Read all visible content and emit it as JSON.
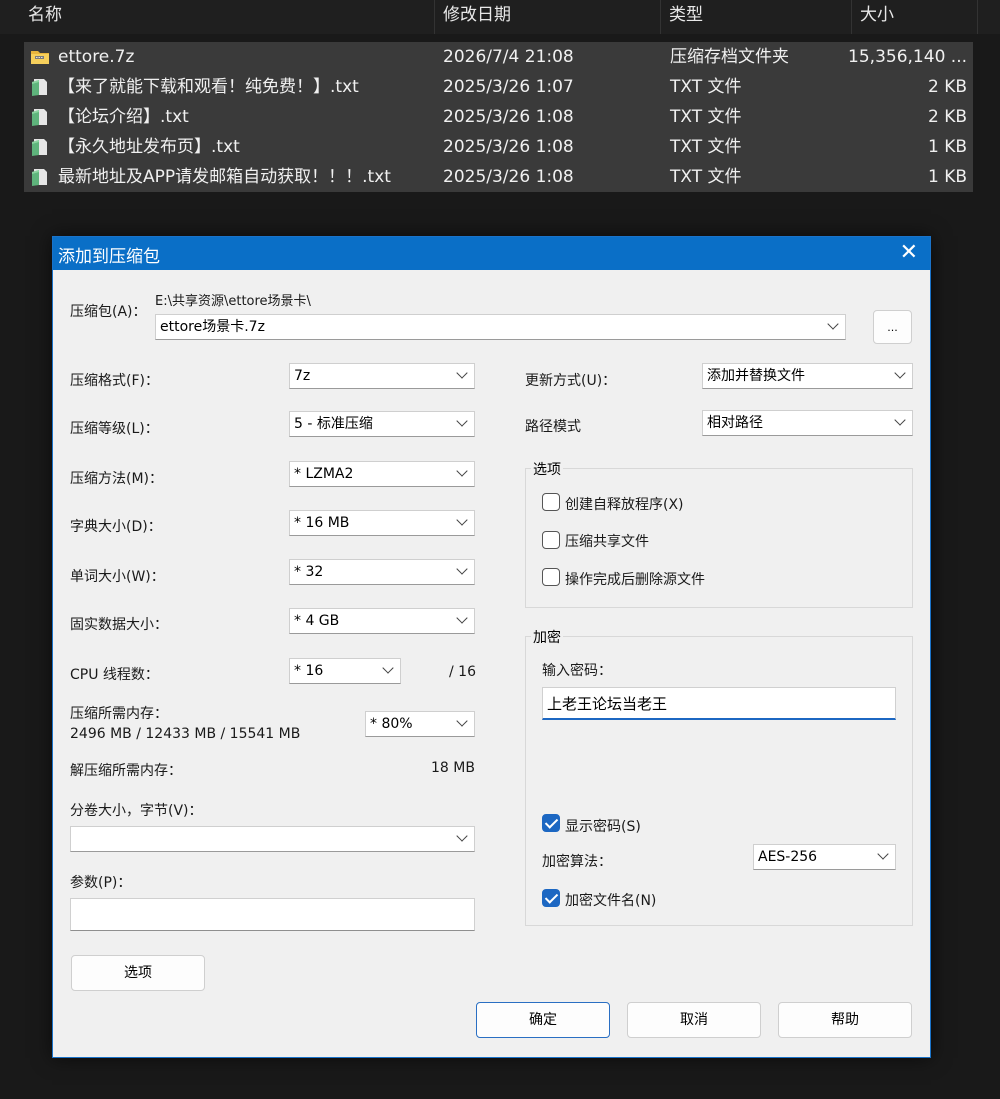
{
  "explorer": {
    "columns": {
      "name": "名称",
      "date": "修改日期",
      "type": "类型",
      "size": "大小"
    },
    "files": [
      {
        "icon": "zip-folder-icon",
        "name": "ettore.7z",
        "date": "2026/7/4 21:08",
        "type": "压缩存档文件夹",
        "size": "15,356,140 ..."
      },
      {
        "icon": "text-file-icon",
        "name": "【来了就能下载和观看！纯免费！】.txt",
        "date": "2025/3/26 1:07",
        "type": "TXT 文件",
        "size": "2 KB"
      },
      {
        "icon": "text-file-icon",
        "name": "【论坛介绍】.txt",
        "date": "2025/3/26 1:08",
        "type": "TXT 文件",
        "size": "2 KB"
      },
      {
        "icon": "text-file-icon",
        "name": "【永久地址发布页】.txt",
        "date": "2025/3/26 1:08",
        "type": "TXT 文件",
        "size": "1 KB"
      },
      {
        "icon": "text-file-icon",
        "name": "最新地址及APP请发邮箱自动获取！！！.txt",
        "date": "2025/3/26 1:08",
        "type": "TXT 文件",
        "size": "1 KB"
      }
    ]
  },
  "dialog": {
    "title": "添加到压缩包",
    "close_icon": "close-icon",
    "archive": {
      "label": "压缩包(A)：",
      "path": "E:\\共享资源\\ettore场景卡\\",
      "value": "ettore场景卡.7z",
      "browse_label": "..."
    },
    "left": {
      "format": {
        "label": "压缩格式(F)：",
        "value": "7z"
      },
      "level": {
        "label": "压缩等级(L)：",
        "value": "5 - 标准压缩"
      },
      "method": {
        "label": "压缩方法(M)：",
        "value": "* LZMA2"
      },
      "dict": {
        "label": "字典大小(D)：",
        "value": "* 16 MB"
      },
      "word": {
        "label": "单词大小(W)：",
        "value": "* 32"
      },
      "solid": {
        "label": "固实数据大小：",
        "value": "* 4 GB"
      },
      "cpu": {
        "label": "CPU 线程数：",
        "value": "* 16",
        "max": "/ 16"
      },
      "mem": {
        "label": "压缩所需内存：",
        "detail": "2496 MB / 12433 MB / 15541 MB",
        "value": "* 80%"
      },
      "decomp": {
        "label": "解压缩所需内存：",
        "value": "18 MB"
      },
      "volume": {
        "label": "分卷大小，字节(V)：",
        "value": ""
      },
      "params": {
        "label": "参数(P)：",
        "value": ""
      },
      "options_button": "选项"
    },
    "right": {
      "update": {
        "label": "更新方式(U)：",
        "value": "添加并替换文件"
      },
      "pathmode": {
        "label": "路径模式",
        "value": "相对路径"
      },
      "options_group": {
        "title": "选项",
        "items": [
          {
            "label": "创建自释放程序(X)",
            "checked": false
          },
          {
            "label": "压缩共享文件",
            "checked": false
          },
          {
            "label": "操作完成后删除源文件",
            "checked": false
          }
        ]
      },
      "encryption": {
        "title": "加密",
        "password_label": "输入密码：",
        "password": "上老王论坛当老王",
        "show_password": {
          "label": "显示密码(S)",
          "checked": true
        },
        "algorithm_label": "加密算法：",
        "algorithm": "AES-256",
        "encrypt_names": {
          "label": "加密文件名(N)",
          "checked": true
        }
      }
    },
    "buttons": {
      "ok": "确定",
      "cancel": "取消",
      "help": "帮助"
    },
    "colors": {
      "titlebar": "#0a6fc7",
      "accent": "#1c67c2",
      "body": "#f0f0f0"
    }
  }
}
